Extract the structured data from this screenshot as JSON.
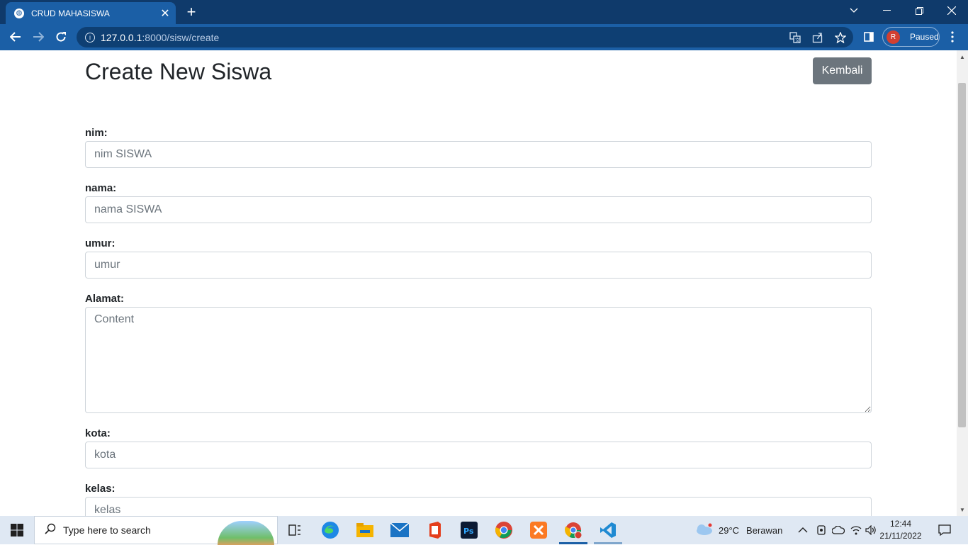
{
  "browser": {
    "tab_title": "CRUD MAHASISWA",
    "url_host": "127.0.0.1",
    "url_path": ":8000/sisw/create",
    "profile_initial": "R",
    "profile_status": "Paused"
  },
  "page": {
    "title": "Create New Siswa",
    "back_label": "Kembali"
  },
  "form": {
    "nim": {
      "label": "nim:",
      "placeholder": "nim SISWA"
    },
    "nama": {
      "label": "nama:",
      "placeholder": "nama SISWA"
    },
    "umur": {
      "label": "umur:",
      "placeholder": "umur"
    },
    "alamat": {
      "label": "Alamat:",
      "placeholder": "Content"
    },
    "kota": {
      "label": "kota:",
      "placeholder": "kota"
    },
    "kelas": {
      "label": "kelas:",
      "placeholder": "kelas"
    }
  },
  "taskbar": {
    "search_placeholder": "Type here to search",
    "weather_temp": "29°C",
    "weather_desc": "Berawan",
    "time": "12:44",
    "date": "21/11/2022",
    "apps": [
      "task-view",
      "edge",
      "file-explorer",
      "mail",
      "office",
      "photoshop",
      "chrome",
      "xampp",
      "chrome-profile",
      "vscode"
    ]
  },
  "colors": {
    "chrome_dark": "#0f3a6b",
    "chrome_toolbar": "#1b5fa6",
    "button_secondary": "#6c757d"
  }
}
